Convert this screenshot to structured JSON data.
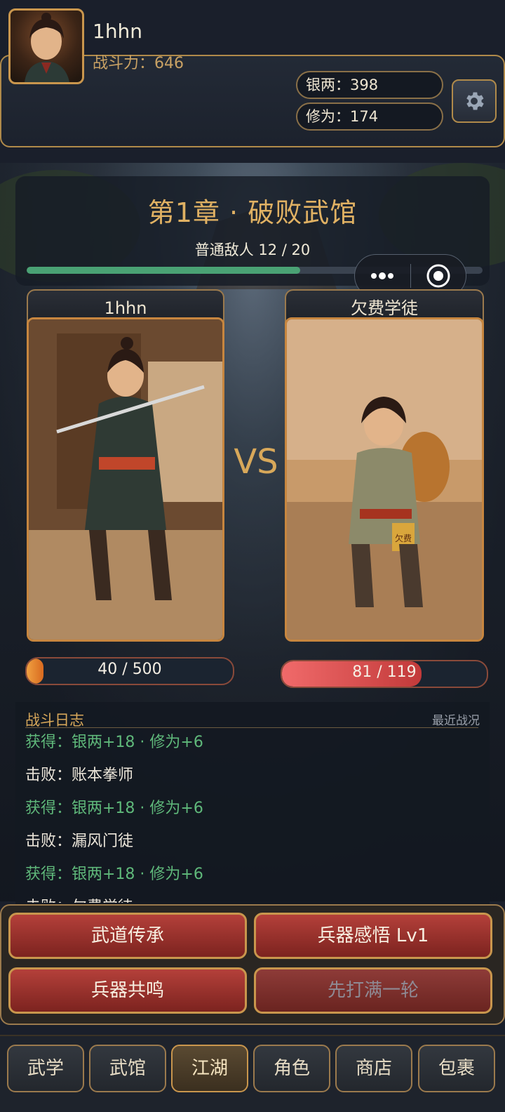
{
  "header": {
    "player_name": "1hhn",
    "power_label": "战斗力：646",
    "silver_label": "银两：398",
    "cultivation_label": "修为：174"
  },
  "stage": {
    "chapter_title": "第1章 · 破败武馆",
    "enemy_progress_label": "普通敌人  12 / 20",
    "enemy_progress": 0.6
  },
  "player": {
    "name": "1hhn",
    "hp_label": "40 / 500",
    "hp_current": 40,
    "hp_max": 500
  },
  "enemy": {
    "name": "欠费学徒",
    "hp_label": "81 / 119",
    "hp_current": 81,
    "hp_max": 119,
    "badge_text": "欠费"
  },
  "vs_label": "VS",
  "battle_log": {
    "title": "战斗日志",
    "subtitle": "最近战况",
    "entries": [
      {
        "type": "reward",
        "text": "获得：银两+18 · 修为+6"
      },
      {
        "type": "defeat",
        "text": "击败：账本拳师"
      },
      {
        "type": "reward",
        "text": "获得：银两+18 · 修为+6"
      },
      {
        "type": "defeat",
        "text": "击败：漏风门徒"
      },
      {
        "type": "reward",
        "text": "获得：银两+18 · 修为+6"
      },
      {
        "type": "defeat",
        "text": "击败：欠费学徒"
      }
    ]
  },
  "actions": {
    "martial_inheritance": "武道传承",
    "weapon_insight": "兵器感悟 Lv1",
    "weapon_resonance": "兵器共鸣",
    "clear_round": "先打满一轮"
  },
  "nav": {
    "tabs": [
      "武学",
      "武馆",
      "江湖",
      "角色",
      "商店",
      "包裹"
    ],
    "active": "江湖"
  },
  "colors": {
    "gold_accent": "#d8a85a",
    "reward_green": "#5fb87a",
    "button_red": "#b4403a",
    "progress_green": "#4aa274"
  },
  "icons": {
    "settings": "gear-icon",
    "more": "more-dots-icon",
    "record": "record-circle-icon"
  }
}
